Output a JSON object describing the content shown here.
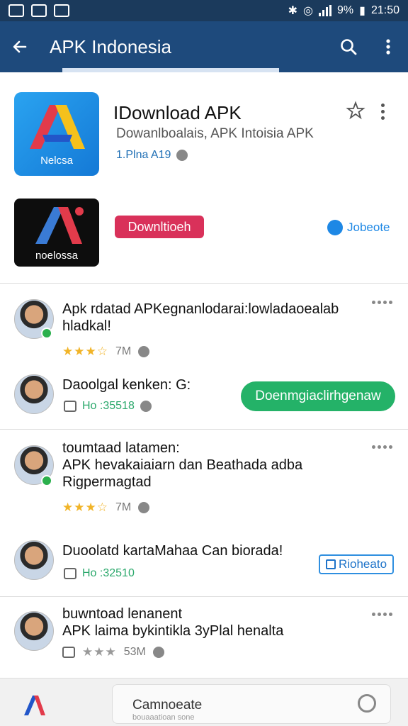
{
  "status_bar": {
    "battery": "9%",
    "time": "21:50"
  },
  "app_bar": {
    "title": "APK Indonesia"
  },
  "app_header": {
    "name": "IDownload APK",
    "subtitle": "Dowanlboalais, APK Intoisia APK",
    "meta": "1.Plna A19",
    "icon1_label": "Nelcsa",
    "icon2_label": "noelossa",
    "download_label": "Downltioeh",
    "verified_label": "Jobeote"
  },
  "feed": [
    {
      "text": "Apk rdatad APKegnanlodarai:lowladaoealab hladkal!",
      "rating_text": "7M",
      "sub_text": "Daoolgal kenken: G:",
      "count": "Ho :35518",
      "action_label": "Doenmgiaclirhgenaw",
      "action_style": "green"
    },
    {
      "text": "toumtaad latamen:\nAPK hevakaiaiarn dan Beathada adba\nRigpermagtad",
      "rating_text": "7M",
      "sub_text": "Duoolatd kartaMahaa Can biorada!",
      "count": "Ho :32510",
      "action_label": "Rioheato",
      "action_style": "outline"
    },
    {
      "text": "buwntoad lenanent\nAPK laima bykintikla 3yPlal henalta",
      "rating_text": "53M"
    }
  ],
  "bottom_bar": {
    "label": "Camnoeate",
    "sublabel": "bouaaatioan sone"
  },
  "colors": {
    "header": "#1e4a7c",
    "accent_green": "#24b268",
    "accent_red": "#d9315a",
    "link_blue": "#1e88e5"
  }
}
